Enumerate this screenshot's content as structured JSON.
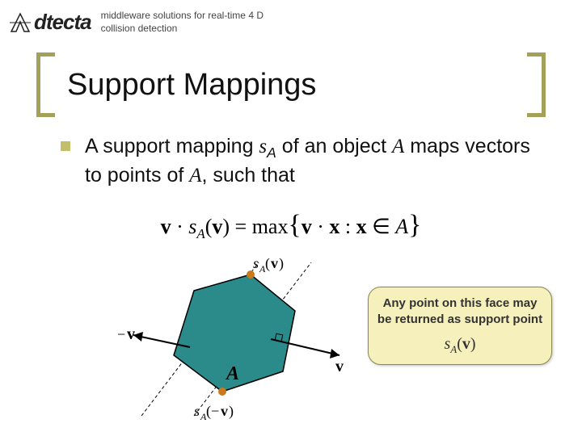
{
  "logo": {
    "text": "dtecta"
  },
  "tagline": "middleware solutions for real-time 4 D collision detection",
  "title": "Support Mappings",
  "bullet": {
    "pre": "A support mapping ",
    "sym": "s",
    "sub": "A",
    "mid": " of an object ",
    "obj": "A",
    "post": " maps vectors to points of ",
    "obj2": "A",
    "tail": ", such that"
  },
  "equation": {
    "text_html": "v · s_A(v) = max{ v · x : x ∈ A }"
  },
  "figure_labels": {
    "sAv": "s_A(v)",
    "v": "v",
    "negv": "−v",
    "A": "A",
    "sAnegv": "s_A(−v)"
  },
  "callout": {
    "line": "Any point on this face may be returned as support point",
    "math": "s_A(v)"
  }
}
